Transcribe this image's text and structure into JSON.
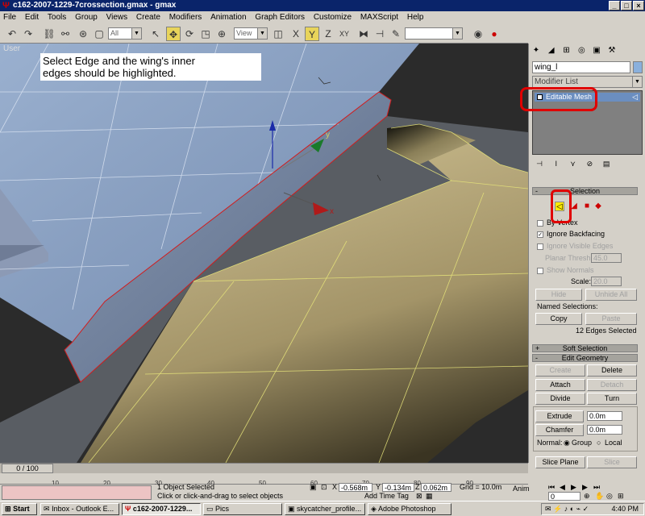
{
  "window": {
    "title": "c162-2007-1229-7crossection.gmax - gmax",
    "minimize": "_",
    "maximize": "□",
    "close": "×"
  },
  "menu": [
    "File",
    "Edit",
    "Tools",
    "Group",
    "Views",
    "Create",
    "Modifiers",
    "Animation",
    "Graph Editors",
    "Customize",
    "MAXScript",
    "Help"
  ],
  "toolbar": {
    "selection_filter": "All",
    "ref_coord": "View",
    "axis_x": "X",
    "axis_y": "Y",
    "axis_z": "Z",
    "axis_xy": "XY"
  },
  "viewport": {
    "label": "User",
    "callout_line1": "Select Edge and the wing's inner",
    "callout_line2": "edges should be highlighted.",
    "gizmo_y": "y",
    "gizmo_x": "x"
  },
  "command_panel": {
    "object_name": "wing_l",
    "modifier_list": "Modifier List",
    "stack_item": "Editable Mesh",
    "selection_rollout": "Selection",
    "by_vertex": "By Vertex",
    "ignore_backfacing": "Ignore Backfacing",
    "ignore_visible_edges": "Ignore Visible Edges",
    "planar_thresh": "Planar Thresh:",
    "planar_thresh_value": "45.0",
    "show_normals": "Show Normals",
    "scale_label": "Scale:",
    "scale_value": "20.0",
    "hide": "Hide",
    "unhide_all": "Unhide All",
    "named_selections": "Named Selections:",
    "copy": "Copy",
    "paste": "Paste",
    "selection_status": "12 Edges Selected",
    "soft_selection": "Soft Selection",
    "edit_geometry": "Edit Geometry",
    "create": "Create",
    "delete": "Delete",
    "attach": "Attach",
    "detach": "Detach",
    "divide": "Divide",
    "turn": "Turn",
    "extrude": "Extrude",
    "extrude_value": "0.0m",
    "chamfer": "Chamfer",
    "chamfer_value": "0.0m",
    "normal_label": "Normal:",
    "group": "Group",
    "local": "Local",
    "slice_plane": "Slice Plane",
    "slice": "Slice"
  },
  "timeline": {
    "frame": "0 / 100",
    "ticks": [
      "10",
      "20",
      "30",
      "40",
      "50",
      "60",
      "70",
      "80",
      "90"
    ]
  },
  "status": {
    "objects_selected": "1 Object Selected",
    "prompt": "Click or click-and-drag to select objects",
    "x_label": "X",
    "x_value": "-0.568m",
    "y_label": "Y",
    "y_value": "-0.134m",
    "z_label": "Z",
    "z_value": "0.062m",
    "grid": "Grid = 10.0m",
    "add_time_tag": "Add Time Tag",
    "anim": "Anim",
    "frame_field": "0"
  },
  "taskbar": {
    "start": "Start",
    "tasks": [
      "Inbox - Outlook E...",
      "c162-2007-1229...",
      "Pics",
      "skycatcher_profile...",
      "Adobe Photoshop"
    ],
    "clock": "4:40 PM"
  }
}
